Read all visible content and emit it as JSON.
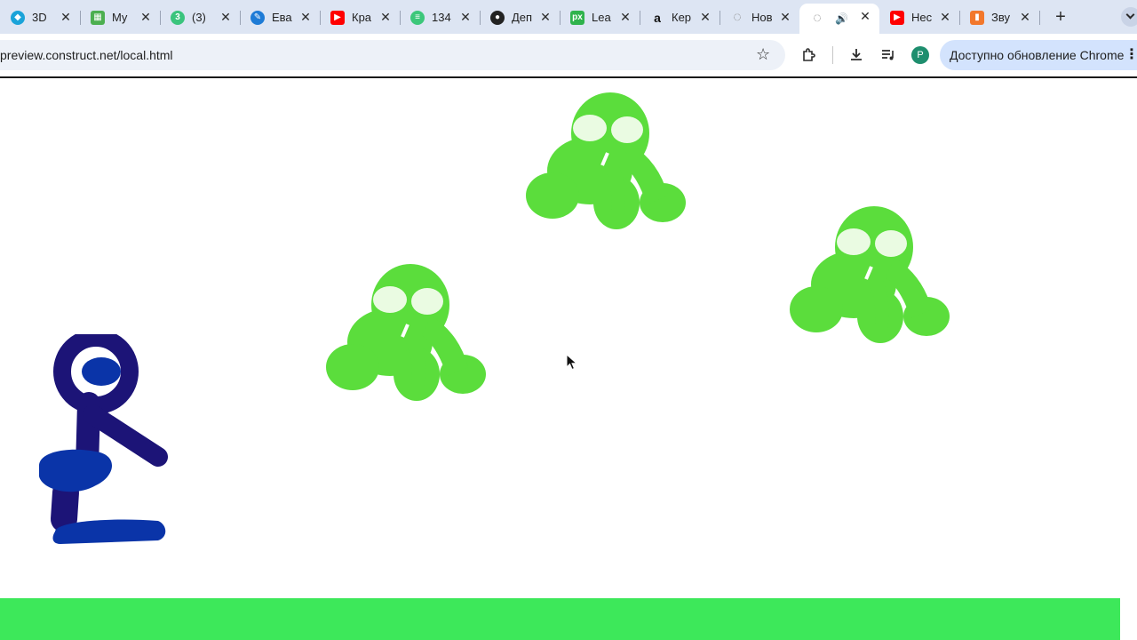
{
  "browser": {
    "tabs": [
      {
        "title": "3D",
        "favicon": "cube-icon",
        "color": "#1aa3d9"
      },
      {
        "title": "My",
        "favicon": "calculator-icon",
        "color": "#4caf50"
      },
      {
        "title": "(3)",
        "favicon": "chat-icon",
        "color": "#3ac47d"
      },
      {
        "title": "Ева",
        "favicon": "pencil-icon",
        "color": "#1e7bd6"
      },
      {
        "title": "Кра",
        "favicon": "youtube-icon",
        "color": "#ff0000"
      },
      {
        "title": "134",
        "favicon": "stack-icon",
        "color": "#3cc77a"
      },
      {
        "title": "Деп",
        "favicon": "face-icon",
        "color": "#222222"
      },
      {
        "title": "Lea",
        "favicon": "px-icon",
        "color": "#2fb34c"
      },
      {
        "title": "Кер",
        "favicon": "amazon-icon",
        "color": "#111111"
      },
      {
        "title": "Нов",
        "favicon": "loading-icon",
        "color": "#888888"
      },
      {
        "title": "",
        "favicon": "loading-icon",
        "color": "#888888",
        "active": true,
        "audio": true
      },
      {
        "title": "Нес",
        "favicon": "youtube-icon",
        "color": "#ff0000"
      },
      {
        "title": "Зву",
        "favicon": "bars-icon",
        "color": "#f2772b"
      }
    ],
    "url": "preview.construct.net/local.html",
    "profile_initial": "P",
    "update_label": "Доступно обновление Chrome"
  },
  "game": {
    "ground_color": "#3de85a",
    "monster_color": "#5bdd3c",
    "monster_eye_color": "#eafbe2",
    "player_colors": {
      "outline": "#1c1477",
      "fill": "#0a34a8"
    }
  }
}
